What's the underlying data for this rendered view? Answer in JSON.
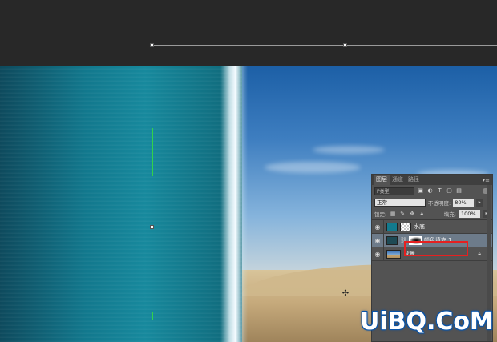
{
  "layers_panel": {
    "tabs": [
      {
        "label": "图层",
        "active": true
      },
      {
        "label": "通道",
        "active": false
      },
      {
        "label": "路径",
        "active": false
      }
    ],
    "filter_kind": "P类型",
    "blend_mode": "正常",
    "opacity_label": "不透明度:",
    "opacity_value": "80%",
    "lock_label": "锁定:",
    "fill_label": "填充:",
    "fill_value": "100%",
    "layers": [
      {
        "name": "水底",
        "visible": true,
        "selected": false
      },
      {
        "name": "颜色填充 1",
        "visible": true,
        "selected": true,
        "highlighted": true
      },
      {
        "name": "背景",
        "visible": true,
        "selected": false,
        "locked": true
      }
    ]
  },
  "watermark": {
    "text": "UiBQ.CoM"
  }
}
